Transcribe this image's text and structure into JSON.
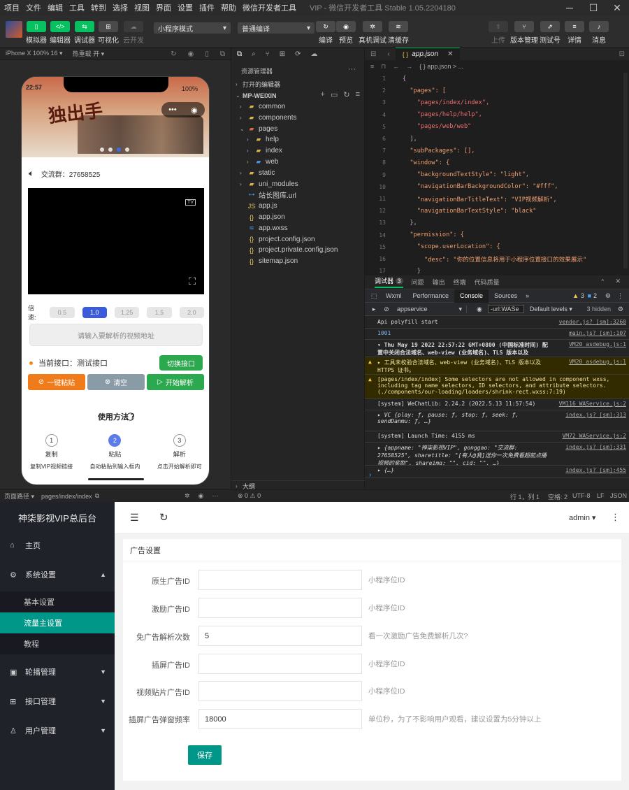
{
  "menubar": {
    "items": [
      "项目",
      "文件",
      "编辑",
      "工具",
      "转到",
      "选择",
      "视图",
      "界面",
      "设置",
      "插件",
      "帮助",
      "微信开发者工具"
    ],
    "window_title": "VIP - 微信开发者工具 Stable 1.05.2204180",
    "controls": {
      "minimize": "─",
      "maximize": "☐",
      "close": "✕"
    }
  },
  "toolbar": {
    "simulator": "模拟器",
    "editor": "编辑器",
    "debugger": "调试器",
    "visual": "可视化",
    "cloud": "云开发",
    "mode_select": "小程序模式",
    "compile_select": "普通编译",
    "compile": "编译",
    "preview": "预览",
    "real_debug": "真机调试",
    "clear_cache": "清缓存",
    "upload": "上传",
    "version": "版本管理",
    "test": "测试号",
    "details": "详情",
    "messages": "消息"
  },
  "simbar": {
    "device": "iPhone X 100% 16 ▾",
    "hot_reload": "热重载 开 ▾"
  },
  "phone": {
    "status_time": "22:57",
    "battery": "100%",
    "banner_title": "独出手",
    "capsule_more": "•••",
    "capsule_close": "◉",
    "group_text": "交流群：27658525",
    "tv_icon": "TV",
    "speed_label": "倍速:",
    "speeds": [
      "0.5",
      "1.0",
      "1.25",
      "1.5",
      "2.0"
    ],
    "active_speed": "1.0",
    "url_placeholder": "请输入要解析的视频地址",
    "current_api": "当前接口：测试接口",
    "switch_api": "切换接口",
    "paste": "一键粘贴",
    "clear": "清空",
    "start": "开始解析",
    "howto_title": "使用方法",
    "steps": [
      {
        "num": "1",
        "title": "复制",
        "desc": "复制VIP视频链接"
      },
      {
        "num": "2",
        "title": "粘贴",
        "desc": "自动粘贴到输入框内"
      },
      {
        "num": "3",
        "title": "解析",
        "desc": "点击开始解析即可"
      }
    ]
  },
  "explorer": {
    "title": "资源管理器",
    "more": "···",
    "open_editors": "打开的编辑器",
    "project": "MP-WEIXIN",
    "items": [
      {
        "name": "common",
        "type": "folder",
        "depth": 1,
        "arrow": "›"
      },
      {
        "name": "components",
        "type": "folder",
        "depth": 1,
        "arrow": "›"
      },
      {
        "name": "pages",
        "type": "folder-open",
        "depth": 1,
        "arrow": "⌄"
      },
      {
        "name": "help",
        "type": "folder",
        "depth": 2,
        "arrow": "›"
      },
      {
        "name": "index",
        "type": "folder",
        "depth": 2,
        "arrow": "›"
      },
      {
        "name": "web",
        "type": "folder-blue",
        "depth": 2,
        "arrow": "›"
      },
      {
        "name": "static",
        "type": "folder",
        "depth": 1,
        "arrow": "›"
      },
      {
        "name": "uni_modules",
        "type": "folder",
        "depth": 1,
        "arrow": "›"
      },
      {
        "name": "站长图库.url",
        "type": "link",
        "depth": 1,
        "arrow": ""
      },
      {
        "name": "app.js",
        "type": "js",
        "depth": 1,
        "arrow": ""
      },
      {
        "name": "app.json",
        "type": "json",
        "depth": 1,
        "arrow": ""
      },
      {
        "name": "app.wxss",
        "type": "wxss",
        "depth": 1,
        "arrow": ""
      },
      {
        "name": "project.config.json",
        "type": "json",
        "depth": 1,
        "arrow": ""
      },
      {
        "name": "project.private.config.json",
        "type": "json",
        "depth": 1,
        "arrow": ""
      },
      {
        "name": "sitemap.json",
        "type": "json",
        "depth": 1,
        "arrow": ""
      }
    ],
    "outline": "大纲"
  },
  "editor": {
    "tab": "app.json",
    "breadcrumb": "{ } app.json > ...",
    "lines": [
      {
        "n": "1",
        "t": "{"
      },
      {
        "n": "2",
        "t": "  \"pages\": ["
      },
      {
        "n": "3",
        "t": "    \"pages/index/index\","
      },
      {
        "n": "4",
        "t": "    \"pages/help/help\","
      },
      {
        "n": "5",
        "t": "    \"pages/web/web\""
      },
      {
        "n": "6",
        "t": "  ],"
      },
      {
        "n": "7",
        "t": "  \"subPackages\": [],"
      },
      {
        "n": "8",
        "t": "  \"window\": {"
      },
      {
        "n": "9",
        "t": "    \"backgroundTextStyle\": \"light\","
      },
      {
        "n": "10",
        "t": "    \"navigationBarBackgroundColor\": \"#fff\","
      },
      {
        "n": "11",
        "t": "    \"navigationBarTitleText\": \"VIP视频解析\","
      },
      {
        "n": "12",
        "t": "    \"navigationBarTextStyle\": \"black\""
      },
      {
        "n": "13",
        "t": "  },"
      },
      {
        "n": "14",
        "t": "  \"permission\": {"
      },
      {
        "n": "15",
        "t": "    \"scope.userLocation\": {"
      },
      {
        "n": "16",
        "t": "      \"desc\": \"你的位置信息将用于小程序位置接口的效果展示\""
      },
      {
        "n": "17",
        "t": "    }"
      }
    ]
  },
  "debugger": {
    "tabs": [
      "调试器",
      "3",
      "问题",
      "输出",
      "终端",
      "代码质量"
    ],
    "subtabs": [
      "Wxml",
      "Performance",
      "Console",
      "Sources",
      "»"
    ],
    "warn_count": "3",
    "info_count": "2",
    "context": "appservice",
    "filter_value": "-url:WASe",
    "levels": "Default levels ▾",
    "hidden": "3 hidden",
    "logs": [
      {
        "text": "Api polyfill start",
        "src": "vendor.js? [sm]:3260",
        "warn": false,
        "h": 13
      },
      {
        "text": "1001",
        "src": "main.js? [sm]:107",
        "warn": false,
        "h": 13,
        "blue": true
      },
      {
        "text": "▾ Thu May 19 2022 22:57:22 GMT+0800 (中国标准时间) 配置中关闭合法域名、web-view (业务域名)、TLS 版本以及 HTTPS 证书检查",
        "src": "VM20 asdebug.js:1",
        "warn": false,
        "h": 22,
        "bold": true
      },
      {
        "text": "▸ 工具未校验合法域名、web-view (业务域名)、TLS 版本以及 HTTPS 证书。",
        "src": "VM20 asdebug.js:1",
        "warn": true,
        "h": 22
      },
      {
        "text": "[pages/index/index] Some selectors are not allowed in component wxss, including tag name selectors, ID selectors, and attribute selectors. (./components/our-loading/loaders/shrink-rect.wxss:7:19)",
        "src": "",
        "warn": true,
        "h": 32
      },
      {
        "text": "[system] WeChatLib: 2.24.2 (2022.5.13 11:57:54)",
        "src": "VM116 WAService.js:2",
        "warn": false,
        "h": 13
      },
      {
        "text": "▸ VC {play: ƒ, pause: ƒ, stop: ƒ, seek: ƒ, sendDanmu: ƒ, …}",
        "src": "index.js? [sm]:313",
        "warn": false,
        "h": 27,
        "italic": true
      },
      {
        "text": "[system] Launch Time: 4155 ms",
        "src": "VM72 WAService.js:2",
        "warn": false,
        "h": 13
      },
      {
        "text": "▸ {appname: \"神柒影视VIP\", gonggao: \"交流群: 27658525\", sharetitle: \"[有人@我]送你一次免费看超前点播视频的奖励\", shareimg: \"\", cid: \"\", …}",
        "src": "index.js? [sm]:331",
        "warn": false,
        "h": 30,
        "italic": true
      },
      {
        "text": "▸ {…}",
        "src": "index.js? [sm]:455",
        "warn": false,
        "h": 14,
        "italic": true
      }
    ]
  },
  "statusbar": {
    "path_label": "页面路径 ▾",
    "path": "pages/index/index",
    "errors": "⊗ 0 ⚠ 0",
    "position": "行 1，列 1",
    "spaces": "空格: 2",
    "encoding": "UTF-8",
    "eol": "LF",
    "lang": "JSON"
  },
  "admin": {
    "title": "神柒影视VIP总后台",
    "user": "admin",
    "nav": [
      {
        "label": "主页",
        "icon": "⌂"
      },
      {
        "label": "系统设置",
        "icon": "⚙",
        "expanded": true
      },
      {
        "label": "轮播管理",
        "icon": "▣"
      },
      {
        "label": "接口管理",
        "icon": "⊞"
      },
      {
        "label": "用户管理",
        "icon": "♙"
      }
    ],
    "subnav": [
      "基本设置",
      "流量主设置",
      "教程"
    ],
    "card_title": "广告设置",
    "fields": [
      {
        "label": "原生广告ID",
        "value": "",
        "hint": "小程序位ID"
      },
      {
        "label": "激励广告ID",
        "value": "",
        "hint": "小程序位ID"
      },
      {
        "label": "免广告解析次数",
        "value": "5",
        "hint": "看一次激励广告免费解析几次?"
      },
      {
        "label": "插屏广告ID",
        "value": "",
        "hint": "小程序位ID"
      },
      {
        "label": "视频贴片广告ID",
        "value": "",
        "hint": "小程序位ID"
      },
      {
        "label": "插屏广告弹窗频率",
        "value": "18000",
        "hint": "单位秒，为了不影响用户观看，建议设置为5分钟以上"
      }
    ],
    "save": "保存"
  },
  "colors": {
    "accent_green": "#07c160",
    "admin_teal": "#009688",
    "sidebar": "#20222a",
    "speed_active": "#3b5bdb"
  }
}
